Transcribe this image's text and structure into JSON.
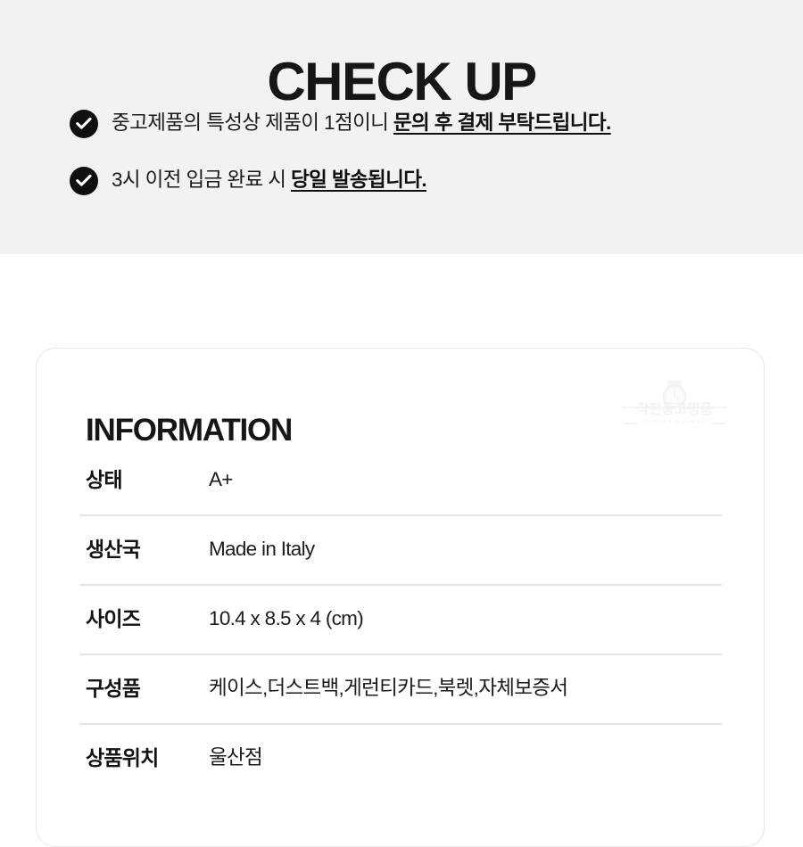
{
  "checkup": {
    "title": "CHECK UP",
    "bullets": [
      {
        "icon": "check-circle-icon",
        "text_plain": "중고제품의 특성상 제품이 1점이니 ",
        "text_emphasis": "문의 후 결제 부탁드립니다."
      },
      {
        "icon": "check-circle-icon",
        "text_plain": "3시 이전 입금 완료 시 ",
        "text_emphasis": "당일 발송됩니다."
      }
    ]
  },
  "information": {
    "heading": "INFORMATION",
    "watermark": {
      "icon": "wrist-watch-icon",
      "brand": "착한중고명품",
      "sub": "LUXURY BRANDS"
    },
    "rows": [
      {
        "label": "상태",
        "value": "A+"
      },
      {
        "label": "생산국",
        "value": "Made in Italy"
      },
      {
        "label": "사이즈",
        "value": "10.4 x 8.5 x 4 (cm)"
      },
      {
        "label": "구성품",
        "value": "케이스,더스트백,게런티카드,북렛,자체보증서"
      },
      {
        "label": "상품위치",
        "value": "울산점"
      }
    ]
  },
  "colors": {
    "band_background": "#f1f2f4",
    "page_background": "#ffffff",
    "text_primary": "#15151a",
    "icon_circle": "#101014",
    "divider": "#e4e4e5",
    "card_border": "#e6e6e8",
    "watermark": "#f3f3f2"
  }
}
